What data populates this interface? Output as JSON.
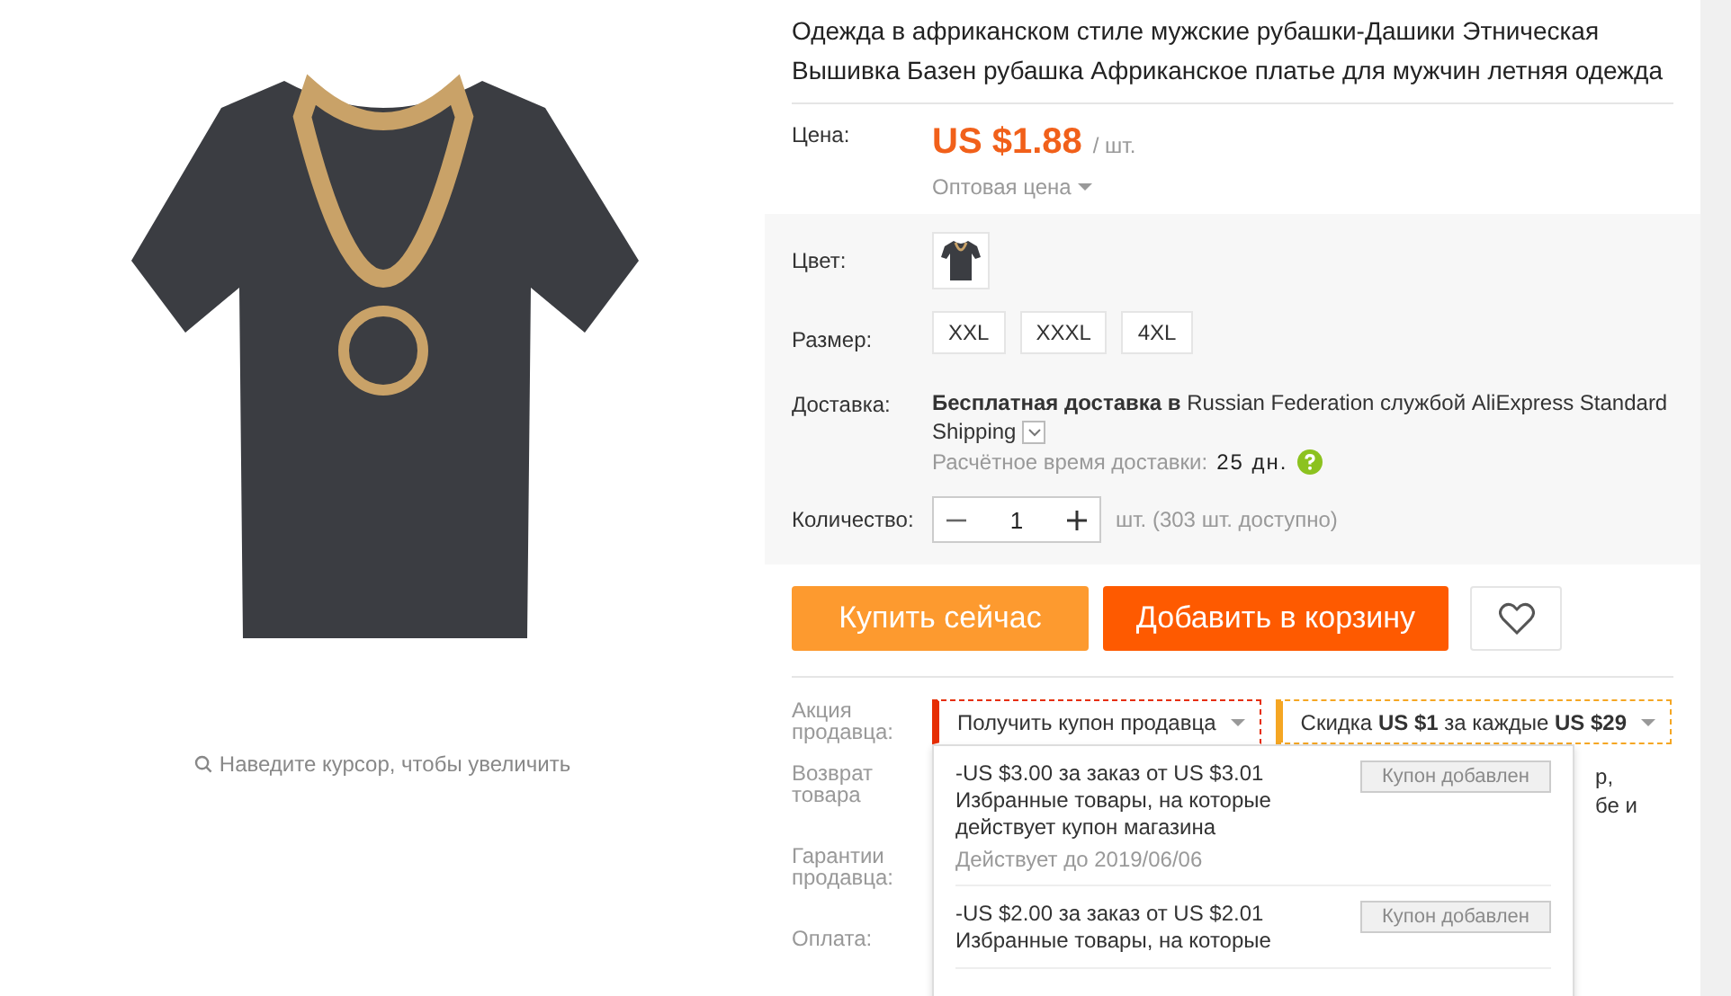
{
  "gallery": {
    "hint": "Наведите курсор, чтобы увеличить"
  },
  "product": {
    "title": "Одежда в африканском стиле мужские рубашки-Дашики Этническая Вышивка Базен рубашка Африканское платье для мужчин летняя одежда",
    "price_label": "Цена:",
    "price": "US $1.88",
    "unit": "/ шт.",
    "wholesale": "Оптовая цена"
  },
  "options": {
    "color_label": "Цвет:",
    "size_label": "Размер:",
    "sizes": [
      {
        "label": "XXL",
        "selected": false
      },
      {
        "label": "XXXL",
        "selected": false
      },
      {
        "label": "4XL",
        "selected": false
      }
    ]
  },
  "delivery": {
    "label": "Доставка:",
    "text": "**Бесплатная доставка в** Russian Federation службой AliExpress Standard Shipping",
    "time_label": "Расчётное время доставки:",
    "time": "25 дн."
  },
  "quantity": {
    "label": "Количество:",
    "value": "1",
    "available": "шт. (303 шт. доступно)"
  },
  "buttons": {
    "buy_now": "Купить сейчас",
    "add_to_cart": "Добавить в корзину"
  },
  "promo": {
    "label": "Акция продавца:",
    "selects": [
      {
        "text": "Получить купон продавца",
        "color": "#e62e04",
        "expanded": true
      },
      {
        "text": "Скидка **US $1** за каждые **US $29**",
        "color": "#f5a623",
        "expanded": false
      }
    ],
    "coupons": [
      {
        "title": "-US $3.00 за заказ от US $3.01",
        "desc": "Избранные товары, на которые действует купон магазина",
        "valid": "Действует до 2019/06/06",
        "button": "Купон добавлен",
        "disabled": true
      },
      {
        "title": "-US $2.00 за заказ от US $2.01",
        "desc": "Избранные товары, на которые",
        "button": "Купон добавлен",
        "disabled": true
      }
    ]
  },
  "rows": [
    {
      "label": "Возврат товара",
      "value_lines": [
        "р,",
        "бе и"
      ]
    },
    {
      "label": "Гарантии продавца:"
    },
    {
      "label": "Оплата:"
    }
  ]
}
